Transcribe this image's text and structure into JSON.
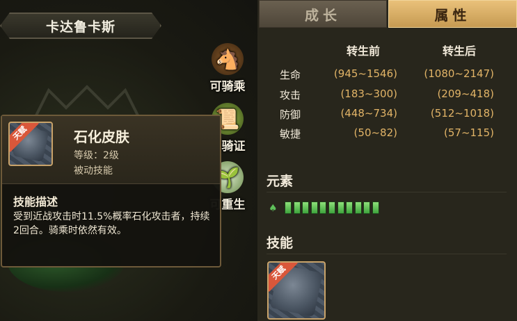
{
  "character": {
    "name": "卡达鲁卡斯"
  },
  "side_actions": [
    {
      "label": "可骑乘",
      "icon": "horse-icon"
    },
    {
      "label": "需骑证",
      "icon": "scroll-icon"
    },
    {
      "label": "可重生",
      "icon": "rebirth-icon"
    }
  ],
  "tooltip": {
    "badge": "天赋",
    "skill_name": "石化皮肤",
    "level": "等级：2级",
    "type": "被动技能",
    "desc_title": "技能描述",
    "desc_text": "受到近战攻击时11.5%概率石化攻击者，持续2回合。骑乘时依然有效。"
  },
  "tabs": [
    {
      "label": "成长",
      "active": false
    },
    {
      "label": "属性",
      "active": true
    }
  ],
  "stats": {
    "col_before": "转生前",
    "col_after": "转生后",
    "rows": [
      {
        "label": "生命",
        "before": "(945~1546)",
        "after": "(1080~2147)"
      },
      {
        "label": "攻击",
        "before": "(183~300)",
        "after": "(209~418)"
      },
      {
        "label": "防御",
        "before": "(448~734)",
        "after": "(512~1018)"
      },
      {
        "label": "敏捷",
        "before": "(50~82)",
        "after": "(57~115)"
      }
    ]
  },
  "element": {
    "title": "元素",
    "type_icon": "leaf-icon",
    "level": 11,
    "color": "#5fc05a"
  },
  "skills": {
    "title": "技能",
    "items": [
      {
        "badge": "天赋"
      }
    ]
  },
  "colors": {
    "accent_gold": "#e2b467",
    "tab_active": "#d9b06a",
    "badge_red": "#d9573a"
  }
}
